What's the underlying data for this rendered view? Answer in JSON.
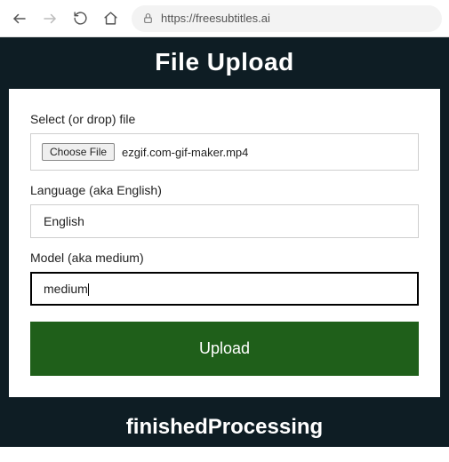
{
  "browser": {
    "url": "https://freesubtitles.ai"
  },
  "header": {
    "title": "File Upload"
  },
  "form": {
    "file_label": "Select (or drop) file",
    "choose_button": "Choose File",
    "file_name": "ezgif.com-gif-maker.mp4",
    "language_label": "Language (aka English)",
    "language_value": "English",
    "model_label": "Model (aka medium)",
    "model_value": "medium",
    "upload_button": "Upload"
  },
  "footer": {
    "status": "finishedProcessing"
  }
}
